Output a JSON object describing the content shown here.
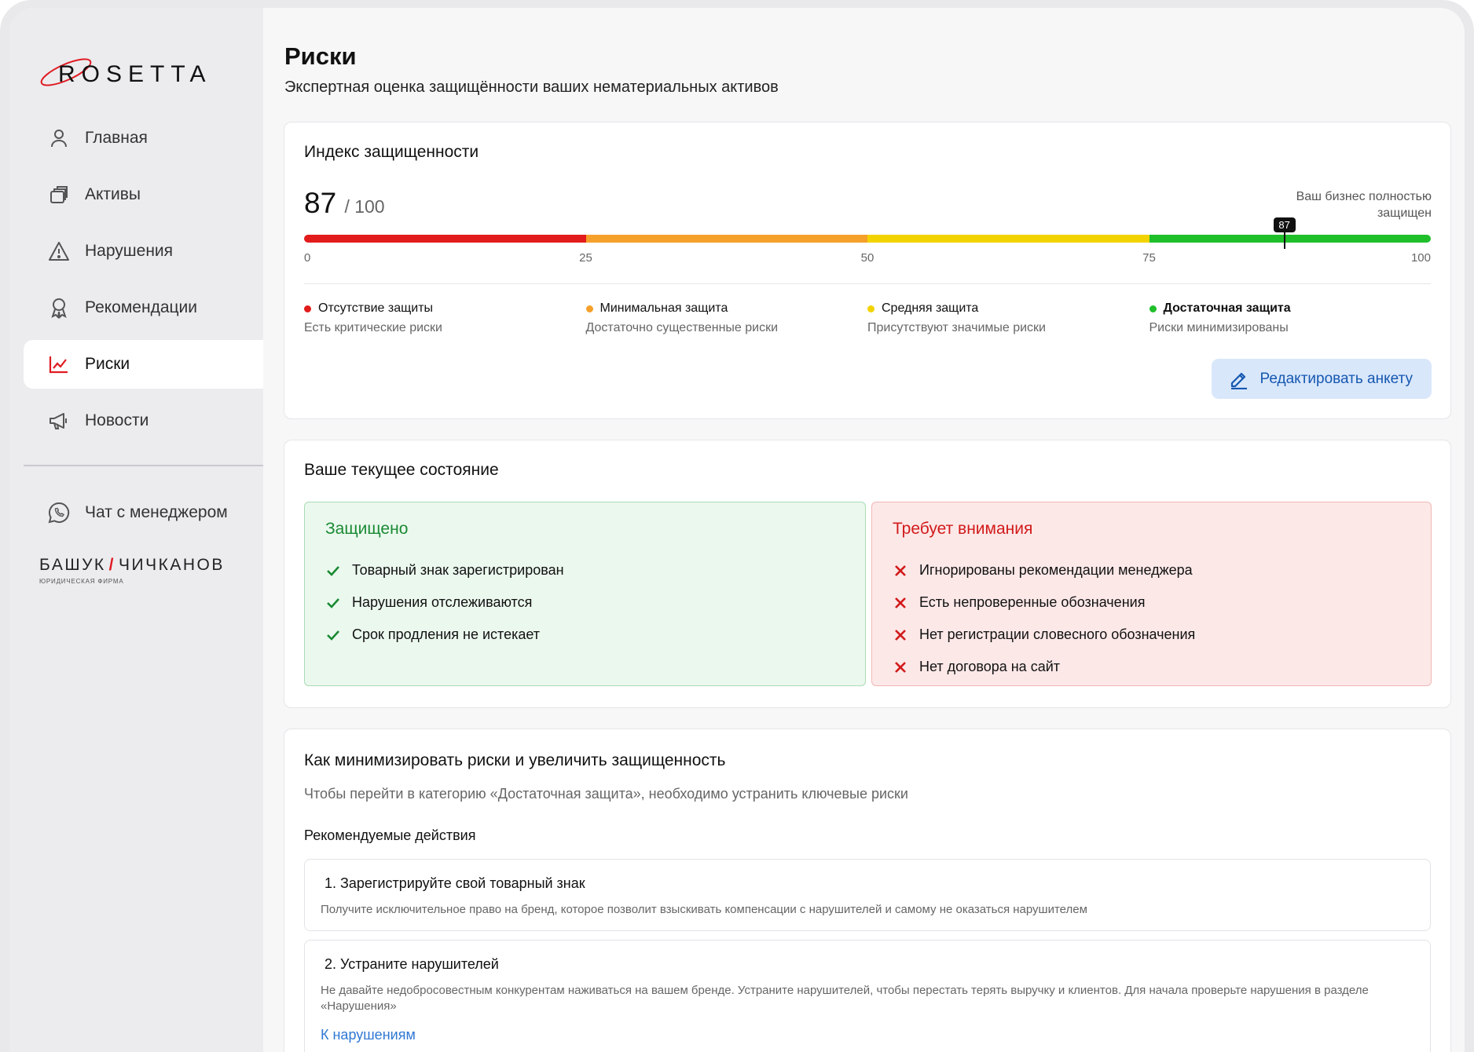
{
  "brand": {
    "logo_text": "ROSETTA",
    "accent": "#e01b22"
  },
  "sidebar": {
    "items": [
      {
        "label": "Главная",
        "icon": "user-icon"
      },
      {
        "label": "Активы",
        "icon": "layers-icon"
      },
      {
        "label": "Нарушения",
        "icon": "warning-icon"
      },
      {
        "label": "Рекомендации",
        "icon": "award-icon"
      },
      {
        "label": "Риски",
        "icon": "chart-icon",
        "active": true
      },
      {
        "label": "Новости",
        "icon": "megaphone-icon"
      }
    ],
    "chat_label": "Чат с менеджером",
    "partner": {
      "left": "БАШУК",
      "slash": "/",
      "right": "ЧИЧКАНОВ",
      "sub": "ЮРИДИЧЕСКАЯ ФИРМА"
    }
  },
  "page": {
    "title": "Риски",
    "subtitle": "Экспертная оценка защищённости ваших нематериальных активов"
  },
  "index_card": {
    "title": "Индекс защищенности",
    "score": "87",
    "score_max": "/ 100",
    "score_value": 87,
    "status_note": "Ваш бизнес полностью защищен",
    "marker_label": "87",
    "ticks": [
      "0",
      "25",
      "50",
      "75",
      "100"
    ],
    "segments_colors": [
      "#e21b1b",
      "#f5a02a",
      "#f2d300",
      "#1fbf2a"
    ],
    "legend": [
      {
        "title": "Отсутствие защиты",
        "desc": "Есть критические риски",
        "color": "#e21b1b",
        "bold": false
      },
      {
        "title": "Минимальная защита",
        "desc": "Достаточно существенные риски",
        "color": "#f5a02a",
        "bold": false
      },
      {
        "title": "Средняя защита",
        "desc": "Присутствуют значимые риски",
        "color": "#f2d300",
        "bold": false
      },
      {
        "title": "Достаточная защита",
        "desc": "Риски минимизированы",
        "color": "#1fbf2a",
        "bold": true
      }
    ],
    "edit_button": "Редактировать анкету"
  },
  "state_card": {
    "title": "Ваше текущее состояние",
    "ok": {
      "title": "Защищено",
      "items": [
        "Товарный знак зарегистрирован",
        "Нарушения отслеживаются",
        "Срок продления не истекает"
      ]
    },
    "warn": {
      "title": "Требует внимания",
      "items": [
        "Игнорированы рекомендации менеджера",
        "Есть непроверенные обозначения",
        "Нет регистрации словесного обозначения",
        "Нет договора на сайт"
      ]
    }
  },
  "reco_card": {
    "title": "Как минимизировать риски и увеличить защищенность",
    "subtitle": "Чтобы перейти в категорию «Достаточная защита», необходимо устранить ключевые риски",
    "actions_heading": "Рекомендуемые действия",
    "actions": [
      {
        "title": "1. Зарегистрируйте свой товарный знак",
        "desc": "Получите исключительное право на бренд, которое позволит взыскивать компенсации с нарушителей и самому не оказаться нарушителем"
      },
      {
        "title": "2. Устраните нарушителей",
        "desc": "Не давайте недобросовестным конкурентам наживаться на вашем бренде. Устраните нарушителей, чтобы перестать терять выручку и клиентов. Для начала проверьте нарушения в разделе «Нарушения»",
        "link": "К нарушениям"
      }
    ]
  }
}
